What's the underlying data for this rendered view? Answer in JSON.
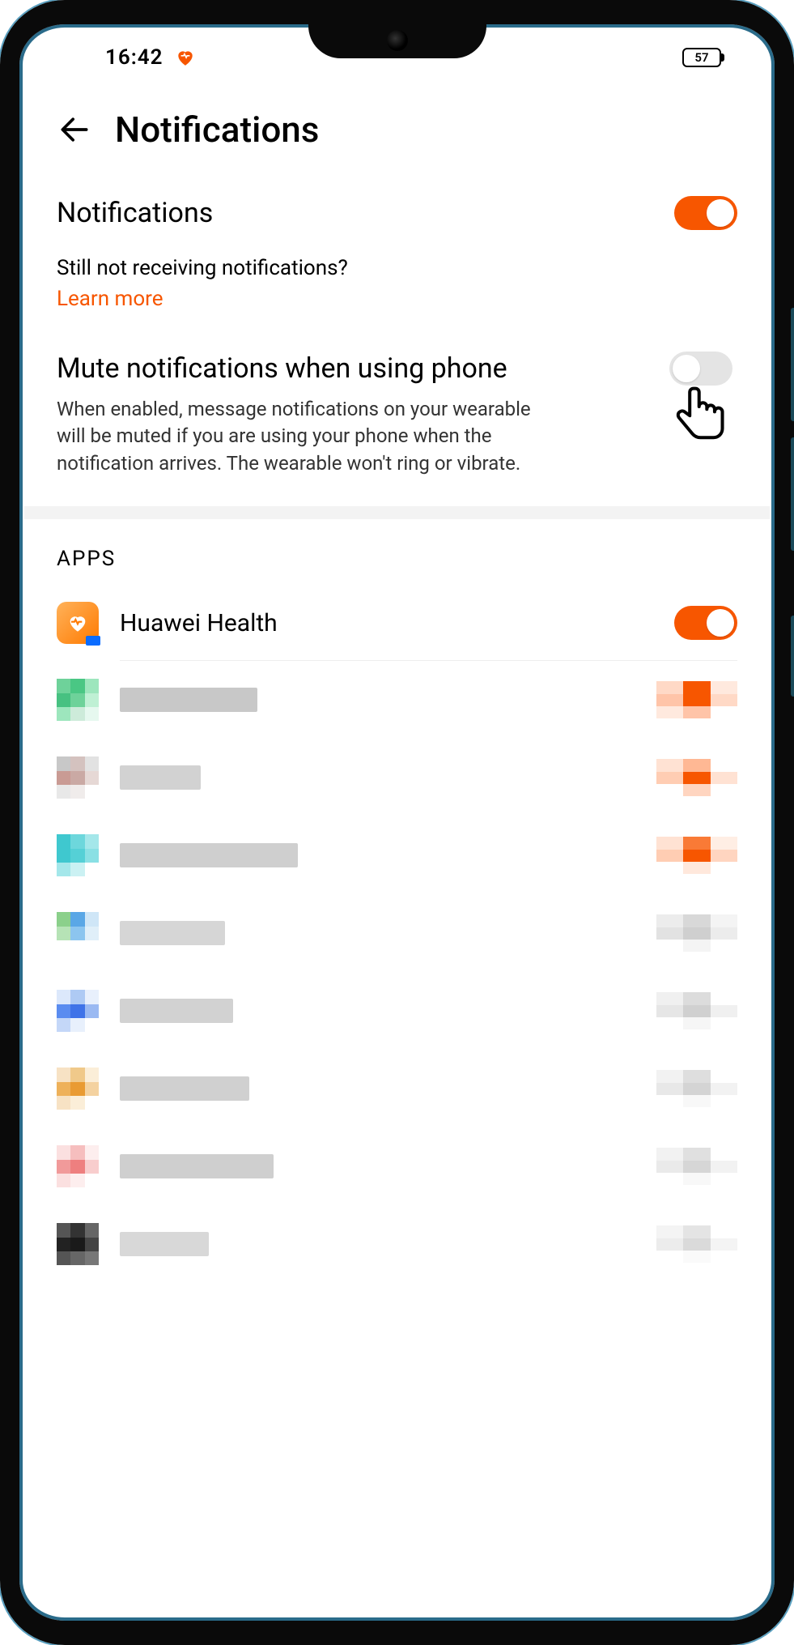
{
  "statusbar": {
    "time": "16:42",
    "battery": "57"
  },
  "header": {
    "title": "Notifications"
  },
  "notifications": {
    "label": "Notifications",
    "enabled": true,
    "helper": "Still not receiving notifications?",
    "learn_more": "Learn more"
  },
  "mute": {
    "title": "Mute notifications when using phone",
    "desc": "When enabled, message notifications on your wearable will be muted if you are using your phone when the notification arrives. The wearable won't ring or vibrate.",
    "enabled": false
  },
  "apps": {
    "header": "APPS",
    "items": [
      {
        "name": "Huawei Health",
        "enabled": true,
        "icon": "huawei-health"
      }
    ]
  },
  "colors": {
    "accent": "#f75600",
    "toggle_off": "#e4e4e4"
  }
}
